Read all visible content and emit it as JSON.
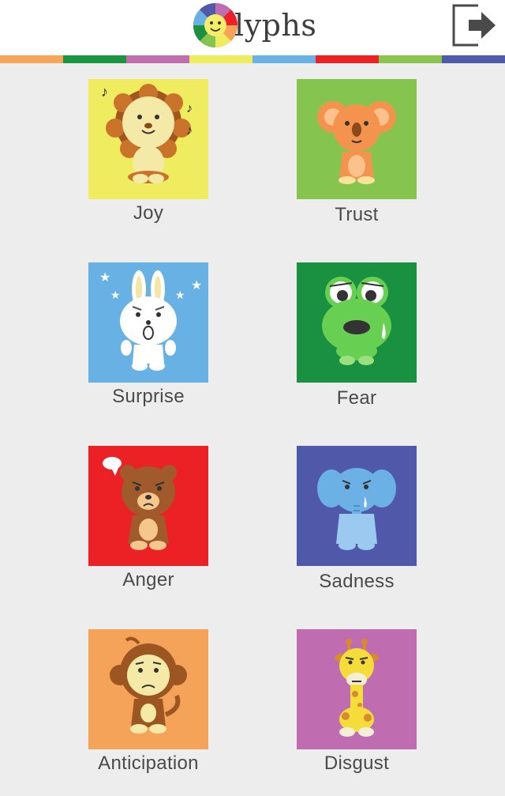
{
  "app": {
    "logo_icon": "rainbow-face-logo",
    "logo_text": "lyphs",
    "logout_icon": "logout-arrow-icon"
  },
  "stripes": [
    "#f5a65a",
    "#1a9640",
    "#c06eb0",
    "#f0ec60",
    "#6cb1e6",
    "#ec2125",
    "#8ac44e",
    "#4f5ba8"
  ],
  "emotions": [
    {
      "label": "Joy",
      "animal": "lion",
      "color": "#f0ec60"
    },
    {
      "label": "Trust",
      "animal": "koala",
      "color": "#86c450"
    },
    {
      "label": "Surprise",
      "animal": "rabbit",
      "color": "#67b1e5"
    },
    {
      "label": "Fear",
      "animal": "frog",
      "color": "#1a9140"
    },
    {
      "label": "Anger",
      "animal": "bear",
      "color": "#ec2125"
    },
    {
      "label": "Sadness",
      "animal": "elephant",
      "color": "#5059a9"
    },
    {
      "label": "Anticipation",
      "animal": "monkey",
      "color": "#f6a35a"
    },
    {
      "label": "Disgust",
      "animal": "giraffe",
      "color": "#bf6db0"
    }
  ]
}
